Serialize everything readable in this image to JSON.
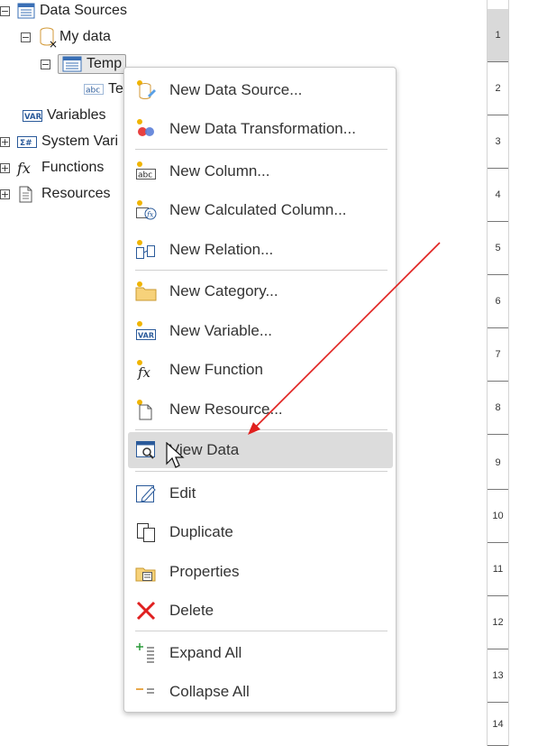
{
  "tree": {
    "data_sources": "Data Sources",
    "my_data": "My data",
    "temp": "Temp",
    "text_child": "Te",
    "variables": "Variables",
    "system_variables": "System Vari",
    "functions": "Functions",
    "resources": "Resources"
  },
  "menu": {
    "new_data_source": "New Data Source...",
    "new_data_transformation": "New Data Transformation...",
    "new_column": "New Column...",
    "new_calculated_column": "New Calculated Column...",
    "new_relation": "New Relation...",
    "new_category": "New Category...",
    "new_variable": "New Variable...",
    "new_function": "New Function",
    "new_resource": "New Resource...",
    "view_data": "View Data",
    "edit": "Edit",
    "duplicate": "Duplicate",
    "properties": "Properties",
    "delete": "Delete",
    "expand_all": "Expand All",
    "collapse_all": "Collapse All"
  },
  "ruler": [
    "1",
    "2",
    "3",
    "4",
    "5",
    "6",
    "7",
    "8",
    "9",
    "10",
    "11",
    "12",
    "13",
    "14"
  ],
  "colors": {
    "accent": "#1f6fd6",
    "arrow": "#e0201e",
    "hover": "#dcdcdc"
  }
}
